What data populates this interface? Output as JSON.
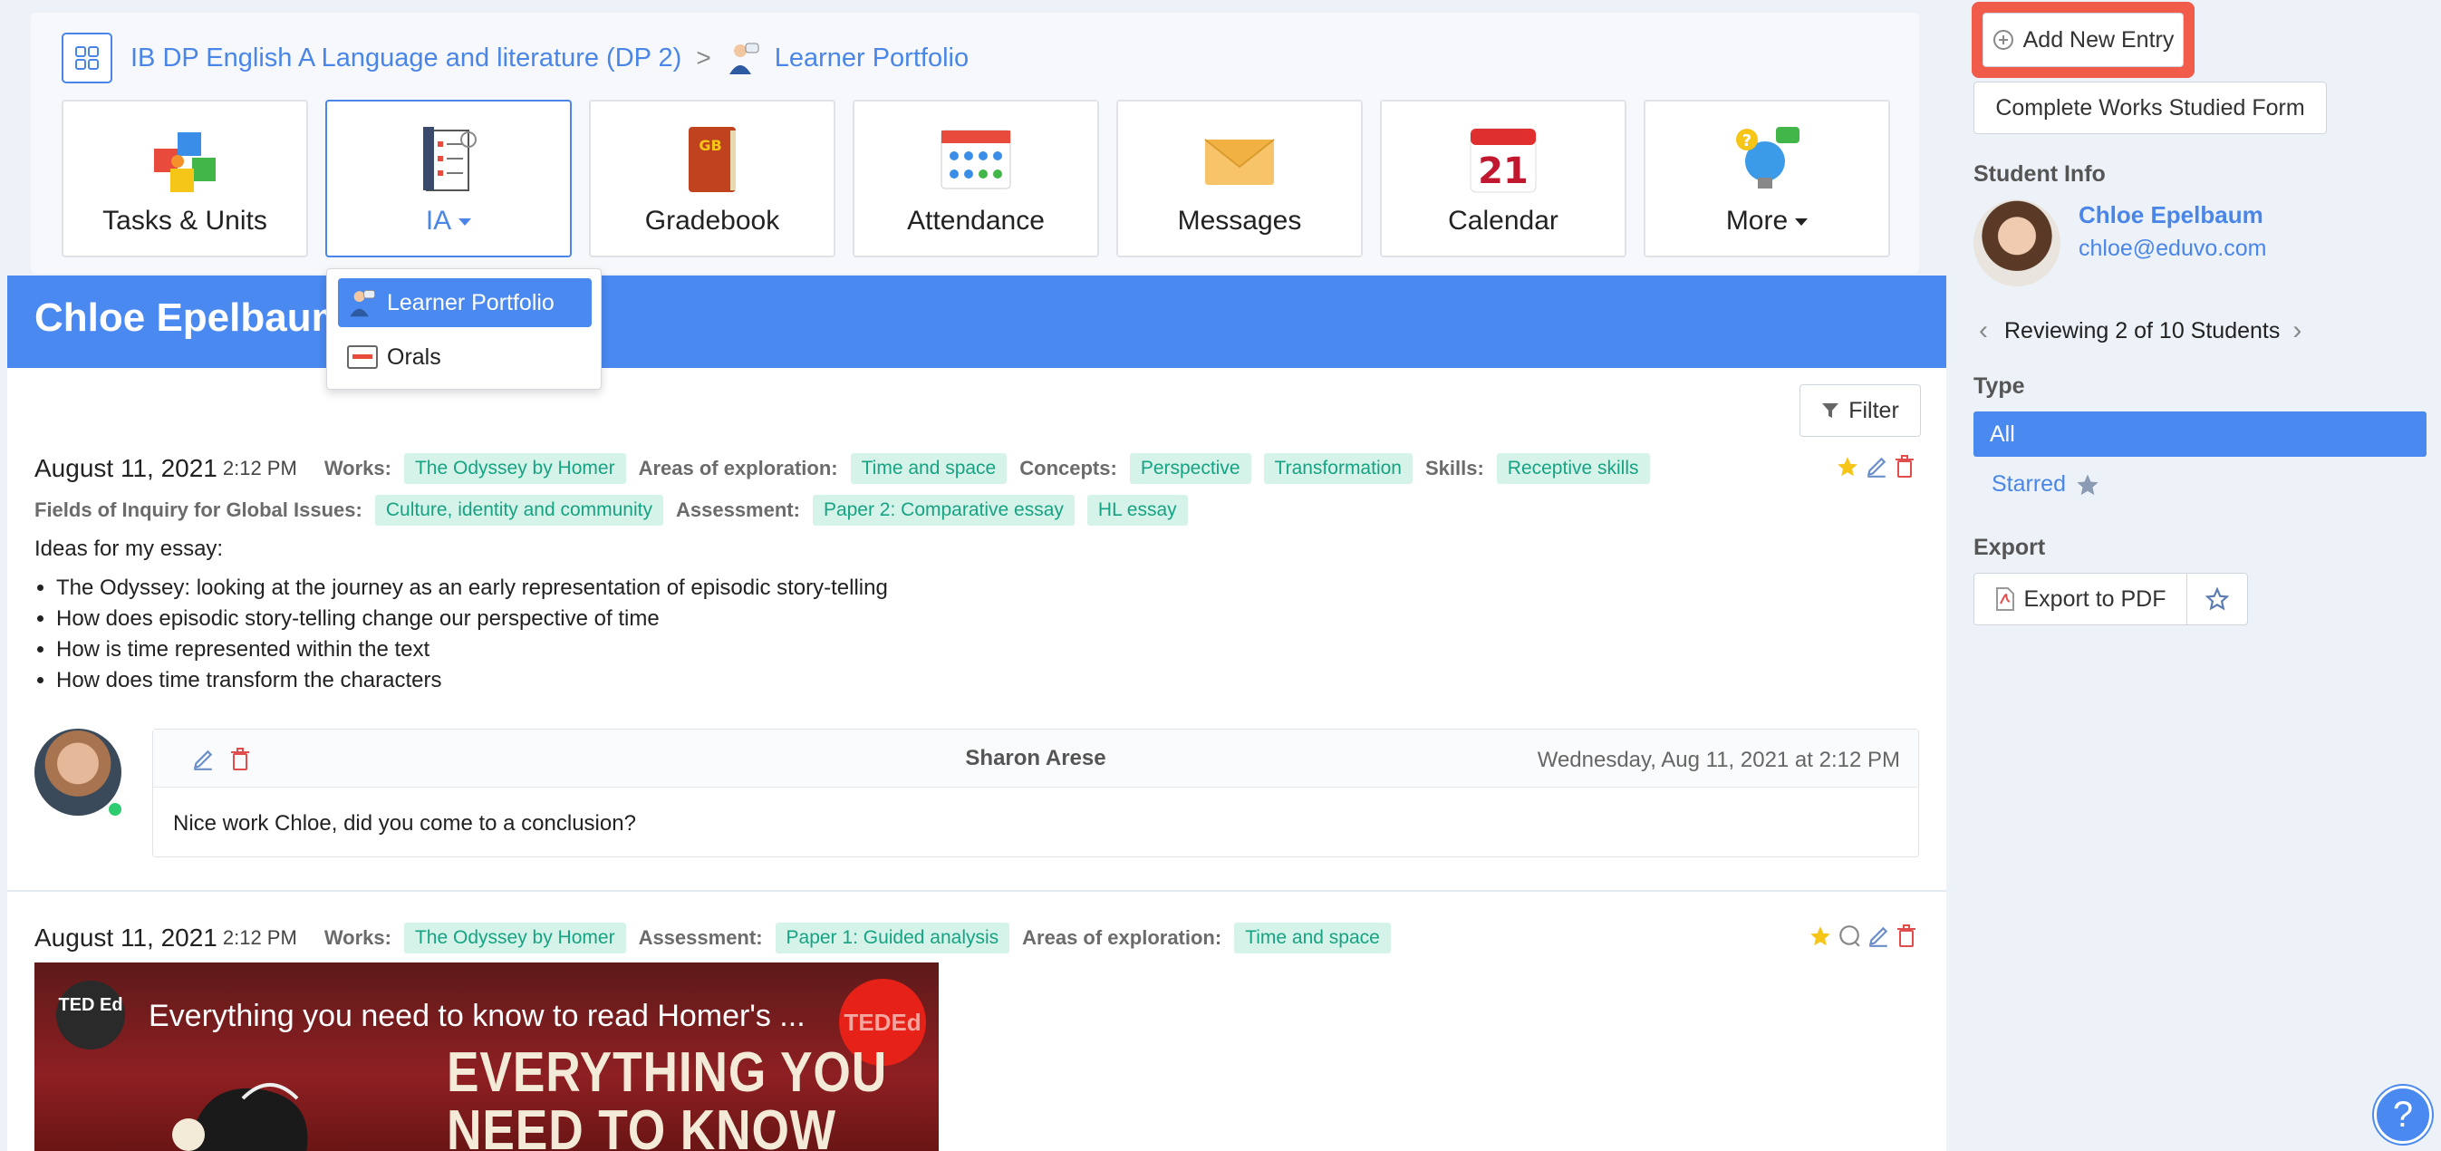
{
  "breadcrumb": {
    "course": "IB DP English A Language and literature (DP 2)",
    "separator": ">",
    "page": "Learner Portfolio"
  },
  "tiles": [
    {
      "label": "Tasks & Units",
      "icon": "puzzle-icon"
    },
    {
      "label": "IA",
      "icon": "checklist-icon",
      "has_caret": true
    },
    {
      "label": "Gradebook",
      "icon": "gradebook-icon"
    },
    {
      "label": "Attendance",
      "icon": "attendance-icon"
    },
    {
      "label": "Messages",
      "icon": "envelope-icon"
    },
    {
      "label": "Calendar",
      "icon": "calendar-icon",
      "calendar_day": "21"
    },
    {
      "label": "More",
      "icon": "lightbulb-icon",
      "has_caret": true
    }
  ],
  "dropdown": {
    "items": [
      {
        "label": "Learner Portfolio",
        "selected": true
      },
      {
        "label": "Orals",
        "selected": false
      }
    ]
  },
  "header": {
    "student_name": "Chloe Epelbaum"
  },
  "filter_label": "Filter",
  "entries": [
    {
      "date": "August 11, 2021",
      "time": "2:12 PM",
      "row1": [
        {
          "key": "Works:",
          "tags": [
            "The Odyssey by Homer"
          ]
        },
        {
          "key": "Areas of exploration:",
          "tags": [
            "Time and space"
          ]
        },
        {
          "key": "Concepts:",
          "tags": [
            "Perspective",
            "Transformation"
          ]
        },
        {
          "key": "Skills:",
          "tags": [
            "Receptive skills"
          ]
        }
      ],
      "row2": [
        {
          "key": "Fields of Inquiry for Global Issues:",
          "tags": [
            "Culture, identity and community"
          ]
        },
        {
          "key": "Assessment:",
          "tags": [
            "Paper 2: Comparative essay",
            "HL essay"
          ]
        }
      ],
      "intro": "Ideas for my essay:",
      "bullets": [
        "The Odyssey: looking at the journey as an early representation of episodic story-telling",
        "How does episodic story-telling change our perspective of time",
        "How is time represented within the text",
        "How does time transform the characters"
      ],
      "comment": {
        "author": "Sharon Arese",
        "timestamp": "Wednesday, Aug 11, 2021 at 2:12 PM",
        "text": "Nice work Chloe, did you come to a conclusion?"
      }
    },
    {
      "date": "August 11, 2021",
      "time": "2:12 PM",
      "row1": [
        {
          "key": "Works:",
          "tags": [
            "The Odyssey by Homer"
          ]
        },
        {
          "key": "Assessment:",
          "tags": [
            "Paper 1: Guided analysis"
          ]
        },
        {
          "key": "Areas of exploration:",
          "tags": [
            "Time and space"
          ]
        }
      ],
      "video": {
        "title": "Everything you need to know to read Homer's ...",
        "channel": "TED Ed",
        "overlay_line1": "EVERYTHING YOU",
        "overlay_line2": "NEED TO KNOW",
        "badge": "TEDEd"
      }
    }
  ],
  "sidebar": {
    "add_entry": "Add New Entry",
    "complete_works": "Complete Works Studied Form",
    "student_info_heading": "Student Info",
    "student_name": "Chloe Epelbaum",
    "student_email": "chloe@eduvo.com",
    "reviewing": "Reviewing 2 of 10 Students",
    "type_heading": "Type",
    "type_all": "All",
    "type_starred": "Starred",
    "export_heading": "Export",
    "export_pdf": "Export to PDF"
  },
  "colors": {
    "accent": "#4a89f0",
    "tag_bg": "#d6f3ea",
    "tag_text": "#16a383",
    "highlight": "#f05b4a",
    "star": "#f5c518",
    "delete": "#e14c4c"
  }
}
